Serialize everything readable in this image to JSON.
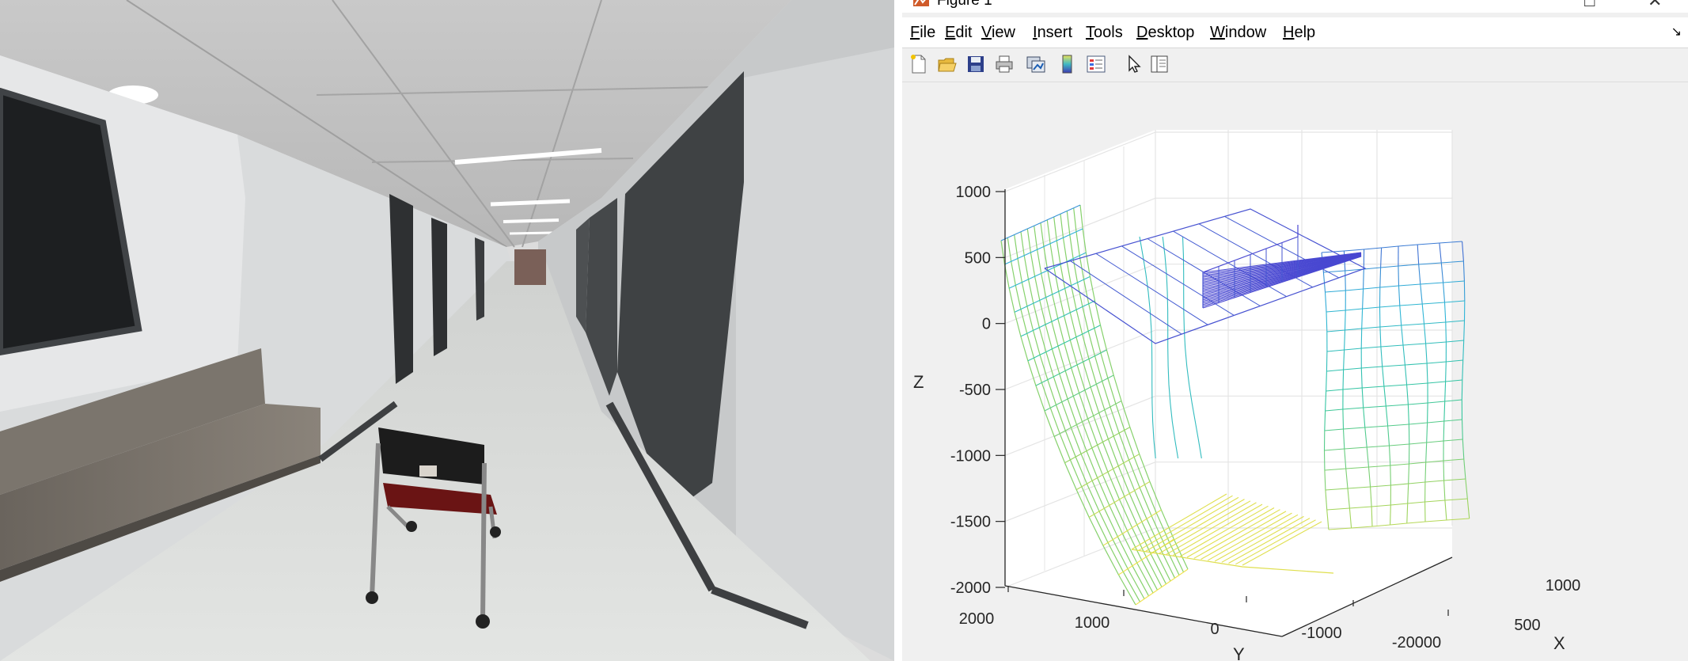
{
  "window": {
    "title": "Figure 1",
    "minimize_glyph": "□",
    "close_glyph": "✕",
    "icon": "matlab-figure-icon"
  },
  "menu": {
    "items": [
      "File",
      "Edit",
      "View",
      "Insert",
      "Tools",
      "Desktop",
      "Window",
      "Help"
    ],
    "dock_glyph": "↘"
  },
  "toolbar": {
    "buttons": [
      "new-figure-icon",
      "open-file-icon",
      "save-icon",
      "print-icon",
      "link-plot-icon",
      "insert-colorbar-icon",
      "insert-legend-icon",
      "select-pointer-icon",
      "property-editor-icon"
    ]
  },
  "photo": {
    "description_icon": "hallway-photo"
  },
  "chart_data": {
    "type": "wireframe-surface-3d",
    "xlabel": "X",
    "ylabel": "Y",
    "zlabel": "Z",
    "x_ticks": [
      "500",
      "1000"
    ],
    "y_ticks": [
      "2000",
      "1000",
      "0",
      "-1000",
      "-20000"
    ],
    "z_ticks": [
      "1000",
      "500",
      "0",
      "-500",
      "-1000",
      "-1500",
      "-2000"
    ],
    "zlim": [
      -2000,
      1000
    ],
    "grid": true,
    "colormap": [
      "#4b3fd0",
      "#2fb4d8",
      "#35c7a0",
      "#9ad35f",
      "#f0e24a"
    ]
  }
}
